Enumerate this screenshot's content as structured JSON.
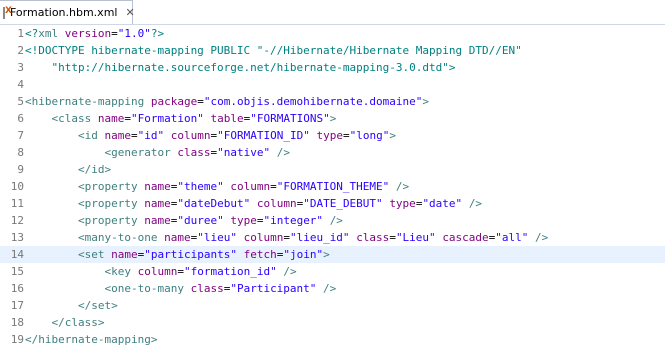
{
  "tab": {
    "label": "Formation.hbm.xml",
    "icon": "xml-file-icon",
    "close_icon": "close-icon"
  },
  "colors": {
    "tag": "#3f7f7f",
    "attribute": "#7f007f",
    "value": "#2a00ff",
    "current_line": "#e8f2fe"
  },
  "editor": {
    "current_line": 14,
    "lines": [
      {
        "n": "1",
        "tokens": [
          [
            "p",
            "<?"
          ],
          [
            "t",
            "xml "
          ],
          [
            "a",
            "version"
          ],
          [
            "x",
            "="
          ],
          [
            "v",
            "\"1.0\""
          ],
          [
            "p",
            "?>"
          ]
        ]
      },
      {
        "n": "2",
        "tokens": [
          [
            "p",
            "<!DOCTYPE hibernate-mapping PUBLIC \"-//Hibernate/Hibernate Mapping DTD//EN\""
          ]
        ]
      },
      {
        "n": "3",
        "tokens": [
          [
            "p",
            "    \"http://hibernate.sourceforge.net/hibernate-mapping-3.0.dtd\">"
          ]
        ]
      },
      {
        "n": "4",
        "tokens": []
      },
      {
        "n": "5",
        "tokens": [
          [
            "t",
            "<hibernate-mapping "
          ],
          [
            "a",
            "package"
          ],
          [
            "x",
            "="
          ],
          [
            "v",
            "\"com.objis.demohibernate.domaine\""
          ],
          [
            "t",
            ">"
          ]
        ]
      },
      {
        "n": "6",
        "tokens": [
          [
            "x",
            "    "
          ],
          [
            "t",
            "<class "
          ],
          [
            "a",
            "name"
          ],
          [
            "x",
            "="
          ],
          [
            "v",
            "\"Formation\""
          ],
          [
            "x",
            " "
          ],
          [
            "a",
            "table"
          ],
          [
            "x",
            "="
          ],
          [
            "v",
            "\"FORMATIONS\""
          ],
          [
            "t",
            ">"
          ]
        ]
      },
      {
        "n": "7",
        "tokens": [
          [
            "x",
            "        "
          ],
          [
            "t",
            "<id "
          ],
          [
            "a",
            "name"
          ],
          [
            "x",
            "="
          ],
          [
            "v",
            "\"id\""
          ],
          [
            "x",
            " "
          ],
          [
            "a",
            "column"
          ],
          [
            "x",
            "="
          ],
          [
            "v",
            "\"FORMATION_ID\""
          ],
          [
            "x",
            " "
          ],
          [
            "a",
            "type"
          ],
          [
            "x",
            "="
          ],
          [
            "v",
            "\"long\""
          ],
          [
            "t",
            ">"
          ]
        ]
      },
      {
        "n": "8",
        "tokens": [
          [
            "x",
            "            "
          ],
          [
            "t",
            "<generator "
          ],
          [
            "a",
            "class"
          ],
          [
            "x",
            "="
          ],
          [
            "v",
            "\"native\""
          ],
          [
            "x",
            " "
          ],
          [
            "t",
            "/>"
          ]
        ]
      },
      {
        "n": "9",
        "tokens": [
          [
            "x",
            "        "
          ],
          [
            "t",
            "</id>"
          ]
        ]
      },
      {
        "n": "10",
        "tokens": [
          [
            "x",
            "        "
          ],
          [
            "t",
            "<property "
          ],
          [
            "a",
            "name"
          ],
          [
            "x",
            "="
          ],
          [
            "v",
            "\"theme\""
          ],
          [
            "x",
            " "
          ],
          [
            "a",
            "column"
          ],
          [
            "x",
            "="
          ],
          [
            "v",
            "\"FORMATION_THEME\""
          ],
          [
            "x",
            " "
          ],
          [
            "t",
            "/>"
          ]
        ]
      },
      {
        "n": "11",
        "tokens": [
          [
            "x",
            "        "
          ],
          [
            "t",
            "<property "
          ],
          [
            "a",
            "name"
          ],
          [
            "x",
            "="
          ],
          [
            "v",
            "\"dateDebut\""
          ],
          [
            "x",
            " "
          ],
          [
            "a",
            "column"
          ],
          [
            "x",
            "="
          ],
          [
            "v",
            "\"DATE_DEBUT\""
          ],
          [
            "x",
            " "
          ],
          [
            "a",
            "type"
          ],
          [
            "x",
            "="
          ],
          [
            "v",
            "\"date\""
          ],
          [
            "x",
            " "
          ],
          [
            "t",
            "/>"
          ]
        ]
      },
      {
        "n": "12",
        "tokens": [
          [
            "x",
            "        "
          ],
          [
            "t",
            "<property "
          ],
          [
            "a",
            "name"
          ],
          [
            "x",
            "="
          ],
          [
            "v",
            "\"duree\""
          ],
          [
            "x",
            " "
          ],
          [
            "a",
            "type"
          ],
          [
            "x",
            "="
          ],
          [
            "v",
            "\"integer\""
          ],
          [
            "x",
            " "
          ],
          [
            "t",
            "/>"
          ]
        ]
      },
      {
        "n": "13",
        "tokens": [
          [
            "x",
            "        "
          ],
          [
            "t",
            "<many-to-one "
          ],
          [
            "a",
            "name"
          ],
          [
            "x",
            "="
          ],
          [
            "v",
            "\"lieu\""
          ],
          [
            "x",
            " "
          ],
          [
            "a",
            "column"
          ],
          [
            "x",
            "="
          ],
          [
            "v",
            "\"lieu_id\""
          ],
          [
            "x",
            " "
          ],
          [
            "a",
            "class"
          ],
          [
            "x",
            "="
          ],
          [
            "v",
            "\"Lieu\""
          ],
          [
            "x",
            " "
          ],
          [
            "a",
            "cascade"
          ],
          [
            "x",
            "="
          ],
          [
            "v",
            "\"all\""
          ],
          [
            "x",
            " "
          ],
          [
            "t",
            "/>"
          ]
        ]
      },
      {
        "n": "14",
        "tokens": [
          [
            "x",
            "        "
          ],
          [
            "t",
            "<set "
          ],
          [
            "a",
            "name"
          ],
          [
            "x",
            "="
          ],
          [
            "v",
            "\"participants\""
          ],
          [
            "x",
            " "
          ],
          [
            "a",
            "fetch"
          ],
          [
            "x",
            "="
          ],
          [
            "v",
            "\"join\""
          ],
          [
            "t",
            ">"
          ]
        ]
      },
      {
        "n": "15",
        "tokens": [
          [
            "x",
            "            "
          ],
          [
            "t",
            "<key "
          ],
          [
            "a",
            "column"
          ],
          [
            "x",
            "="
          ],
          [
            "v",
            "\"formation_id\""
          ],
          [
            "x",
            " "
          ],
          [
            "t",
            "/>"
          ]
        ]
      },
      {
        "n": "16",
        "tokens": [
          [
            "x",
            "            "
          ],
          [
            "t",
            "<one-to-many "
          ],
          [
            "a",
            "class"
          ],
          [
            "x",
            "="
          ],
          [
            "v",
            "\"Participant\""
          ],
          [
            "x",
            " "
          ],
          [
            "t",
            "/>"
          ]
        ]
      },
      {
        "n": "17",
        "tokens": [
          [
            "x",
            "        "
          ],
          [
            "t",
            "</set>"
          ]
        ]
      },
      {
        "n": "18",
        "tokens": [
          [
            "x",
            "    "
          ],
          [
            "t",
            "</class>"
          ]
        ]
      },
      {
        "n": "19",
        "tokens": [
          [
            "t",
            "</hibernate-mapping>"
          ]
        ]
      }
    ]
  }
}
